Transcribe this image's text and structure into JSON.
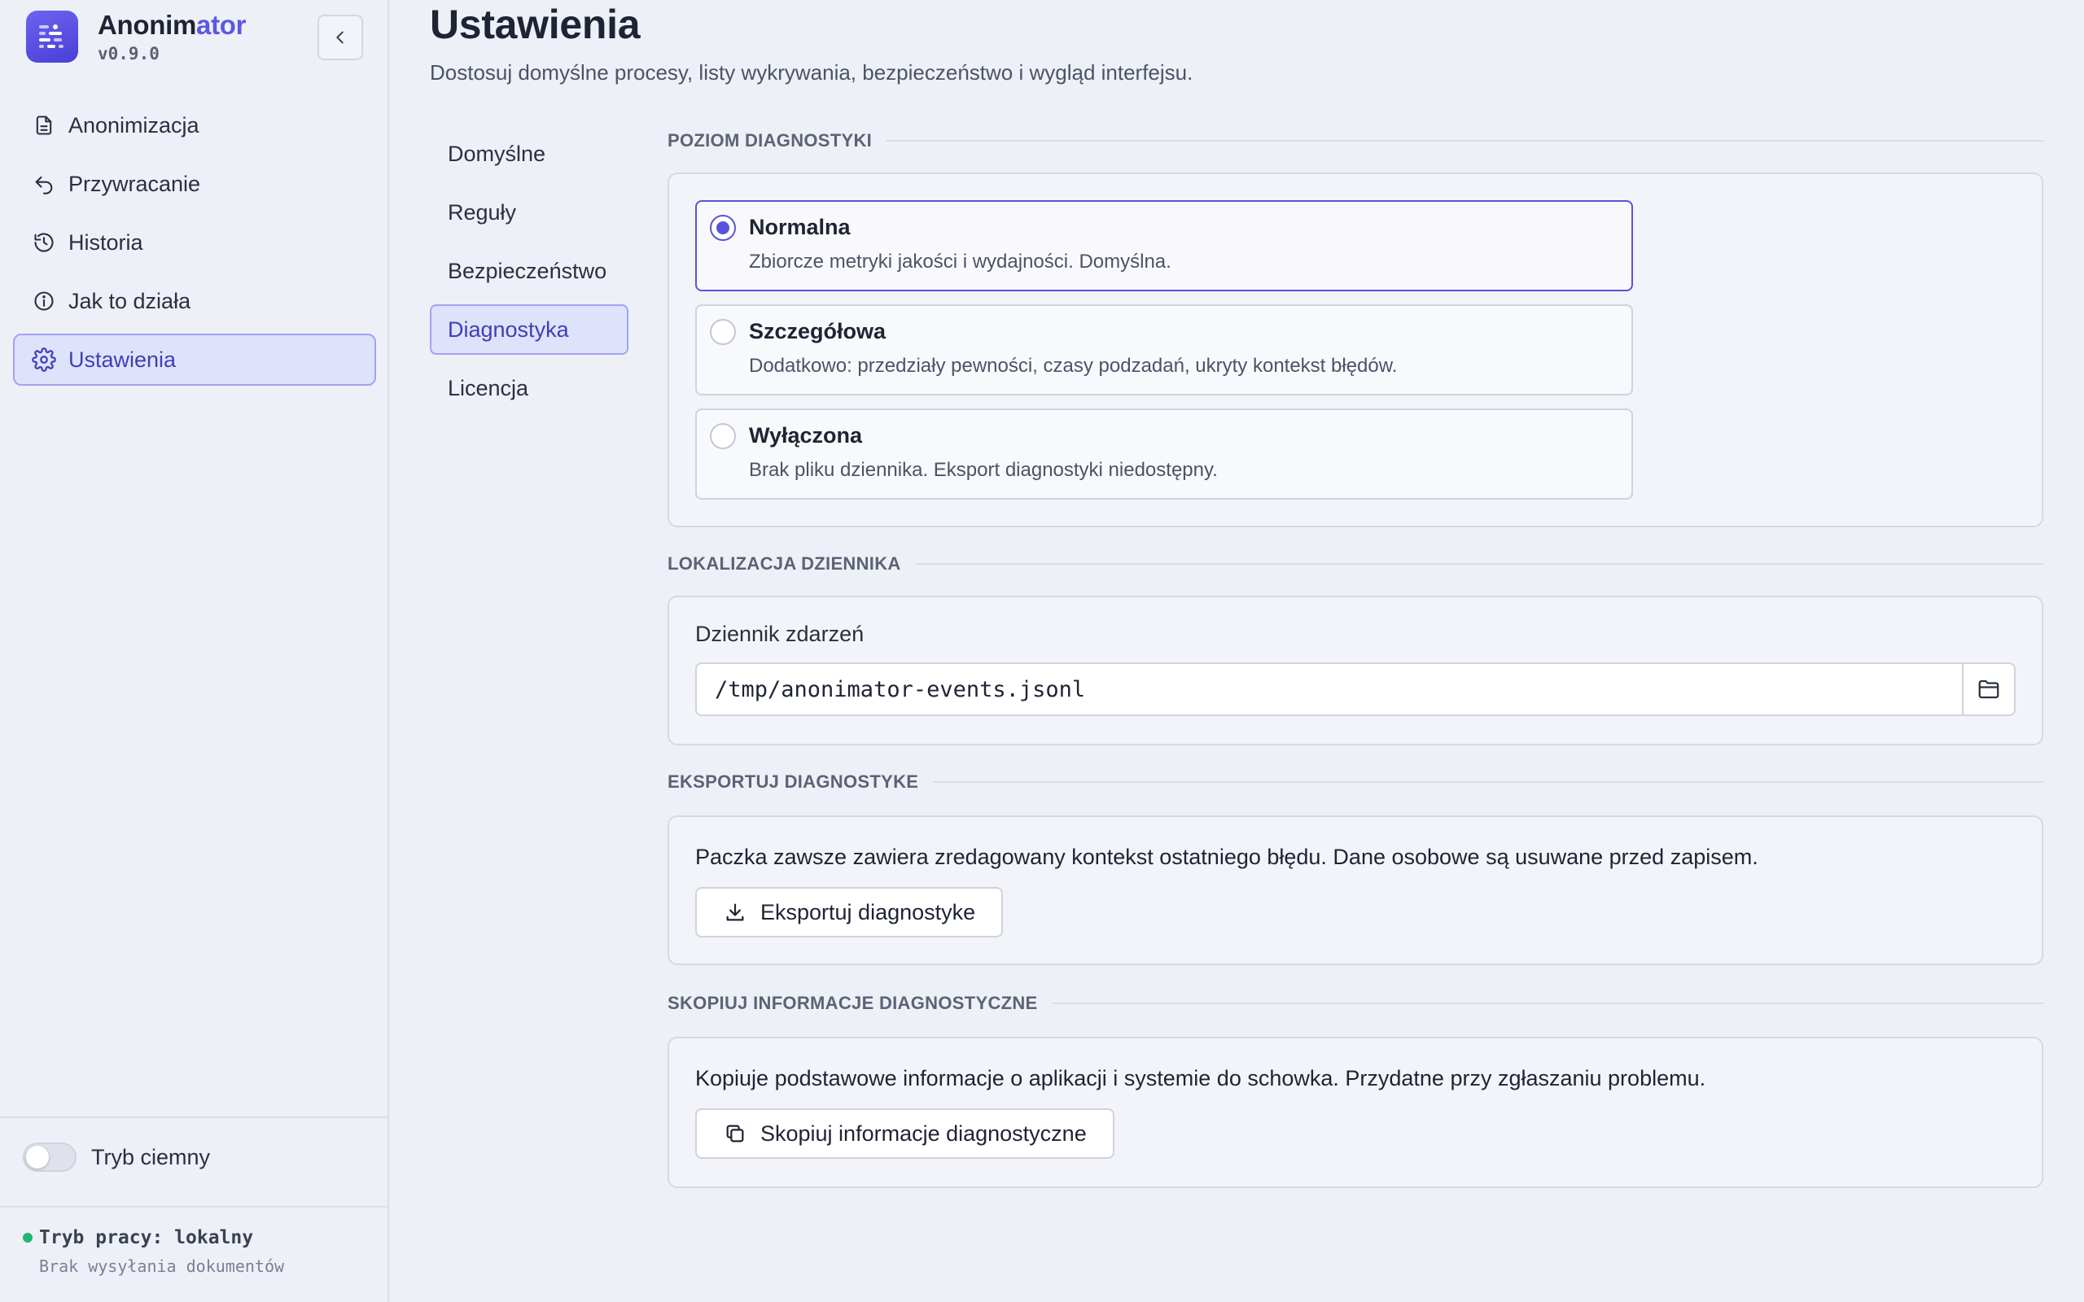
{
  "app": {
    "name_part1": "Anonim",
    "name_part2": "ator",
    "version": "v0.9.0"
  },
  "sidebar": {
    "items": [
      {
        "label": "Anonimizacja",
        "icon": "document-icon"
      },
      {
        "label": "Przywracanie",
        "icon": "undo-arrow-icon"
      },
      {
        "label": "Historia",
        "icon": "history-icon"
      },
      {
        "label": "Jak to działa",
        "icon": "info-icon"
      },
      {
        "label": "Ustawienia",
        "icon": "gear-icon",
        "active": true
      }
    ],
    "dark_mode_label": "Tryb ciemny",
    "dark_mode_on": false,
    "work_mode_title": "Tryb pracy: lokalny",
    "work_mode_sub": "Brak wysyłania dokumentów"
  },
  "page": {
    "title": "Ustawienia",
    "subtitle": "Dostosuj domyślne procesy, listy wykrywania, bezpieczeństwo i wygląd interfejsu."
  },
  "subnav": {
    "items": [
      "Domyślne",
      "Reguły",
      "Bezpieczeństwo",
      "Diagnostyka",
      "Licencja"
    ],
    "active": "Diagnostyka"
  },
  "diagnostics": {
    "level_header": "POZIOM DIAGNOSTYKI",
    "options": [
      {
        "title": "Normalna",
        "desc": "Zbiorcze metryki jakości i wydajności. Domyślna.",
        "selected": true
      },
      {
        "title": "Szczegółowa",
        "desc": "Dodatkowo: przedziały pewności, czasy podzadań, ukryty kontekst błędów.",
        "selected": false
      },
      {
        "title": "Wyłączona",
        "desc": "Brak pliku dziennika. Eksport diagnostyki niedostępny.",
        "selected": false
      }
    ],
    "log_header": "LOKALIZACJA DZIENNIKA",
    "log_label": "Dziennik zdarzeń",
    "log_path": "/tmp/anonimator-events.jsonl",
    "export_header": "EKSPORTUJ DIAGNOSTYKE",
    "export_text": "Paczka zawsze zawiera zredagowany kontekst ostatniego błędu. Dane osobowe są usuwane przed zapisem.",
    "export_button": "Eksportuj diagnostyke",
    "copy_header": "SKOPIUJ INFORMACJE DIAGNOSTYCZNE",
    "copy_text": "Kopiuje podstawowe informacje o aplikacji i systemie do schowka. Przydatne przy zgłaszaniu problemu.",
    "copy_button": "Skopiuj informacje diagnostyczne"
  },
  "colors": {
    "accent": "#5a52d8",
    "active_bg": "#dfe2fb",
    "status_green": "#1fb673"
  }
}
